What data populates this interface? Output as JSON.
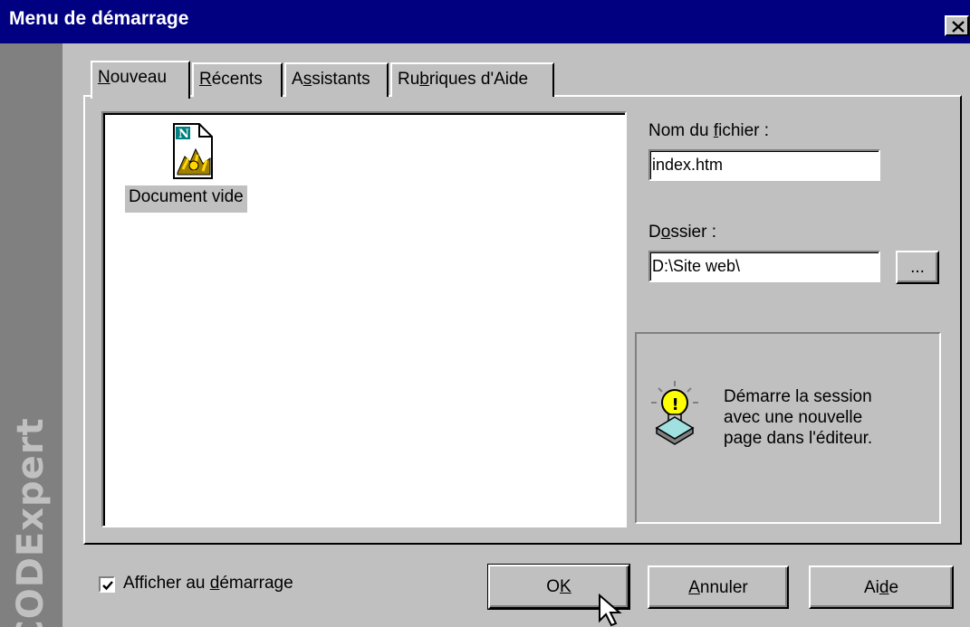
{
  "window": {
    "title": "Menu de démarrage",
    "close_glyph": "✕"
  },
  "brand": {
    "vertical_text": "CODExpert"
  },
  "tabs": [
    {
      "pre": "",
      "key": "N",
      "post": "ouveau",
      "active": true
    },
    {
      "pre": "",
      "key": "R",
      "post": "écents",
      "active": false
    },
    {
      "pre": "A",
      "key": "s",
      "post": "sistants",
      "active": false
    },
    {
      "pre": "Ru",
      "key": "b",
      "post": "riques d'Aide",
      "active": false
    }
  ],
  "file_list": {
    "items": [
      {
        "label": "Document vide",
        "icon": "blank-document-icon",
        "selected": true
      }
    ]
  },
  "filename": {
    "label_pre": "Nom du ",
    "label_key": "f",
    "label_post": "ichier :",
    "value": "index.htm"
  },
  "folder": {
    "label_pre": "D",
    "label_key": "o",
    "label_post": "ssier :",
    "value": "D:\\Site web\\",
    "browse_label": "..."
  },
  "info": {
    "icon": "lightbulb-icon",
    "text_lines": [
      "Démarre la session",
      "avec une nouvelle",
      "page dans l'éditeur."
    ]
  },
  "startup_checkbox": {
    "checked": true,
    "label_pre": "Afficher au ",
    "label_key": "d",
    "label_post": "émarrage"
  },
  "buttons": {
    "ok": {
      "pre": "O",
      "key": "K",
      "post": ""
    },
    "cancel": {
      "pre": "",
      "key": "A",
      "post": "nnuler"
    },
    "help": {
      "pre": "Ai",
      "key": "d",
      "post": "e"
    }
  },
  "colors": {
    "titlebar": "#000080",
    "face": "#c0c0c0",
    "brand_strip": "#808080"
  }
}
